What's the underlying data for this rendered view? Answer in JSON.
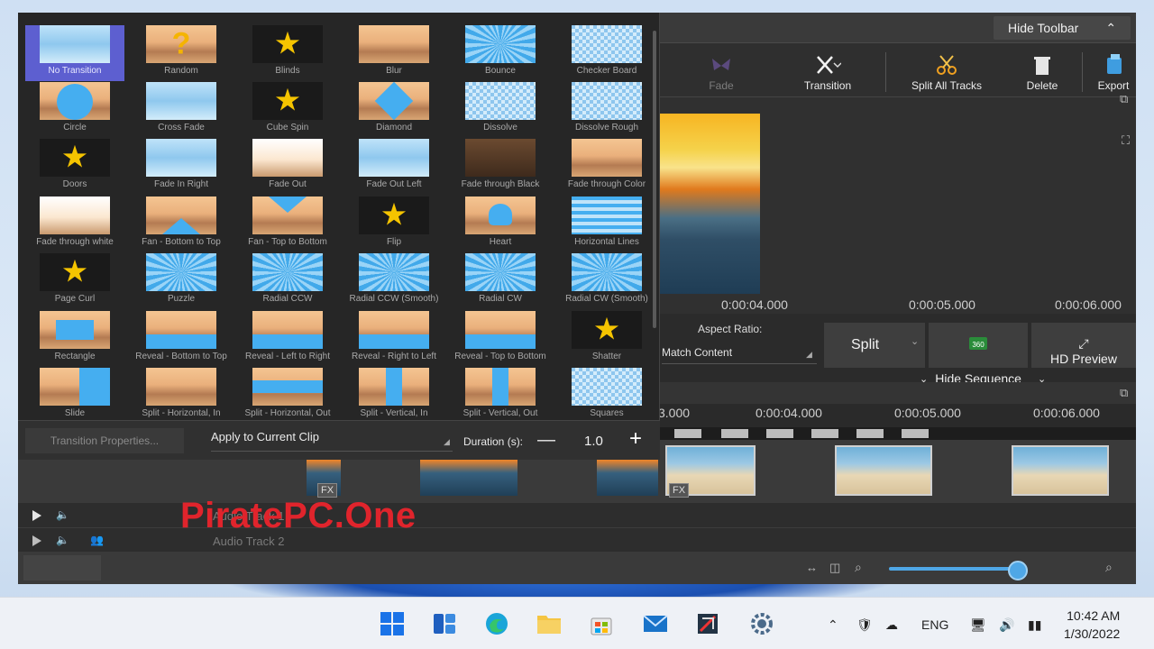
{
  "toolbar": {
    "hide_toolbar_label": "Hide Toolbar",
    "tools": [
      {
        "label": "Fade",
        "enabled": false
      },
      {
        "label": "Transition",
        "enabled": true
      },
      {
        "label": "Split All Tracks",
        "enabled": true
      },
      {
        "label": "Delete",
        "enabled": true
      },
      {
        "label": "Export",
        "enabled": true
      }
    ]
  },
  "transitions": [
    "No Transition",
    "Random",
    "Blinds",
    "Blur",
    "Bounce",
    "Checker Board",
    "Circle",
    "Cross Fade",
    "Cube Spin",
    "Diamond",
    "Dissolve",
    "Dissolve Rough",
    "Doors",
    "Fade In Right",
    "Fade Out",
    "Fade Out Left",
    "Fade through Black",
    "Fade through Color",
    "Fade through white",
    "Fan - Bottom to Top",
    "Fan - Top to Bottom",
    "Flip",
    "Heart",
    "Horizontal Lines",
    "Page Curl",
    "Puzzle",
    "Radial CCW",
    "Radial CCW (Smooth)",
    "Radial CW",
    "Radial CW (Smooth)",
    "Rectangle",
    "Reveal - Bottom to Top",
    "Reveal - Left to Right",
    "Reveal - Right to Left",
    "Reveal - Top to Bottom",
    "Shatter",
    "Slide",
    "Split - Horizontal, In",
    "Split - Horizontal, Out",
    "Split - Vertical, In",
    "Split - Vertical, Out",
    "Squares"
  ],
  "selected_transition": "No Transition",
  "transition_panel": {
    "properties_button": "Transition Properties...",
    "apply_option": "Apply to Current Clip",
    "duration_label": "Duration (s):",
    "duration_minus": "—",
    "duration_value": "1.0",
    "duration_plus": "+"
  },
  "preview": {
    "ruler": [
      "0:00:04.000",
      "0:00:05.000",
      "0:00:06.000"
    ],
    "aspect_ratio_label": "Aspect Ratio:",
    "aspect_ratio_value": "Match Content",
    "split_label": "Split",
    "hd_preview_label": "HD Preview",
    "hide_sequence_label": "Hide Sequence"
  },
  "timeline": {
    "ruler": [
      "3.000",
      "0:00:04.000",
      "0:00:05.000",
      "0:00:06.000"
    ],
    "fx_label": "FX",
    "tracks": [
      "Audio Track 1",
      "Audio Track 2"
    ]
  },
  "watermark": "PiratePC.One",
  "taskbar": {
    "language": "ENG",
    "time": "10:42 AM",
    "date": "1/30/2022"
  }
}
